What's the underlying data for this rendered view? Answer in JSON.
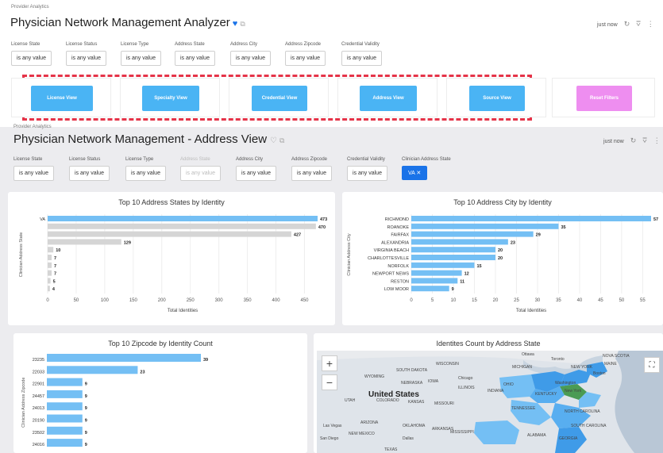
{
  "dashboard1": {
    "breadcrumb": "Provider Analytics",
    "title": "Physician Network Management Analyzer",
    "refresh": "just now",
    "filters": [
      {
        "label": "License State",
        "value": "is any value"
      },
      {
        "label": "License Status",
        "value": "is any value"
      },
      {
        "label": "License Type",
        "value": "is any value"
      },
      {
        "label": "Address State",
        "value": "is any value"
      },
      {
        "label": "Address City",
        "value": "is any value"
      },
      {
        "label": "Address Zipcode",
        "value": "is any value"
      },
      {
        "label": "Credential Validity",
        "value": "is any value"
      }
    ],
    "buttons": [
      {
        "label": "License View",
        "color": "#4ab4f4"
      },
      {
        "label": "Specialty View",
        "color": "#4ab4f4"
      },
      {
        "label": "Credential View",
        "color": "#4ab4f4"
      },
      {
        "label": "Address View",
        "color": "#4ab4f4"
      },
      {
        "label": "Source View",
        "color": "#4ab4f4"
      },
      {
        "label": "Reset Filters",
        "color": "#ee8ef0"
      }
    ]
  },
  "dashboard2": {
    "breadcrumb": "Provider Analytics",
    "title": "Physician Network Management - Address View",
    "refresh": "just now",
    "filters": [
      {
        "label": "License State",
        "value": "is any value"
      },
      {
        "label": "License Status",
        "value": "is any value"
      },
      {
        "label": "License Type",
        "value": "is any value"
      },
      {
        "label": "Address State",
        "value": "is any value"
      },
      {
        "label": "Address City",
        "value": "is any value"
      },
      {
        "label": "Address Zipcode",
        "value": "is any value"
      },
      {
        "label": "Credential Validity",
        "value": "is any value"
      },
      {
        "label": "Clinician Address State",
        "value": "VA"
      }
    ]
  },
  "map": {
    "title": "Identites Count by Address State",
    "labels": [
      "Ottawa",
      "Toronto",
      "NOVA SCOTIA",
      "NEW YORK",
      "WYOMING",
      "SOUTH DAKOTA",
      "Chicago",
      "Boston",
      "United States",
      "New York",
      "Washington",
      "UTAH",
      "COLORADO",
      "KANSAS",
      "MISSOURI",
      "OHIO",
      "ILLINOIS",
      "INDIANA",
      "KENTUCKY",
      "Las Vegas",
      "San Diego",
      "ARIZONA",
      "NEW MEXICO",
      "Dallas",
      "OKLAHOMA",
      "ARKANSAS",
      "TEXAS",
      "GEORGIA",
      "MISSISSIPPI",
      "NEBRASKA",
      "IOWA",
      "MICHIGAN",
      "WISCONSIN",
      "MAINE",
      "TENNESSEE",
      "NORTH CAROLINA",
      "SOUTH CAROLINA",
      "ALABAMA"
    ]
  },
  "chart_data": [
    {
      "type": "bar",
      "orientation": "horizontal",
      "title": "Top 10 Address States by Identity",
      "xlabel": "Total Identities",
      "ylabel": "Clinician Address State",
      "categories": [
        "VA",
        "",
        "",
        "",
        "",
        "",
        "",
        "",
        "",
        ""
      ],
      "values": [
        473,
        470,
        427,
        129,
        10,
        7,
        7,
        7,
        5,
        4
      ],
      "highlight": [
        true,
        false,
        false,
        false,
        false,
        false,
        false,
        false,
        false,
        false
      ],
      "xticks": [
        0,
        50,
        100,
        150,
        200,
        250,
        300,
        350,
        400,
        450
      ],
      "xlim": [
        0,
        473
      ]
    },
    {
      "type": "bar",
      "orientation": "horizontal",
      "title": "Top 10 Address City by Identity",
      "xlabel": "Total Identities",
      "ylabel": "Clinician Address City",
      "categories": [
        "RICHMOND",
        "ROANOKE",
        "FAIRFAX",
        "ALEXANDRIA",
        "VIRGINIA BEACH",
        "CHARLOTTESVILLE",
        "NORFOLK",
        "NEWPORT NEWS",
        "RESTON",
        "LOW MOOR"
      ],
      "values": [
        57,
        35,
        29,
        23,
        20,
        20,
        15,
        12,
        11,
        9
      ],
      "xticks": [
        0,
        5,
        10,
        15,
        20,
        25,
        30,
        35,
        40,
        45,
        50,
        55
      ],
      "xlim": [
        0,
        57
      ]
    },
    {
      "type": "bar",
      "orientation": "horizontal",
      "title": "Top 10 Zipcode by Identity Count",
      "ylabel": "Clinician Address Zipcode",
      "categories": [
        "23235",
        "22033",
        "22901",
        "24457",
        "24013",
        "20190",
        "23502",
        "24016"
      ],
      "values": [
        39,
        23,
        9,
        9,
        9,
        9,
        9,
        9
      ],
      "xlim": [
        0,
        39
      ]
    }
  ],
  "colors": {
    "bar": "#74bff4",
    "bar_muted": "#d5d5d5",
    "accent": "#1a73e8",
    "dash": "#e53348"
  }
}
